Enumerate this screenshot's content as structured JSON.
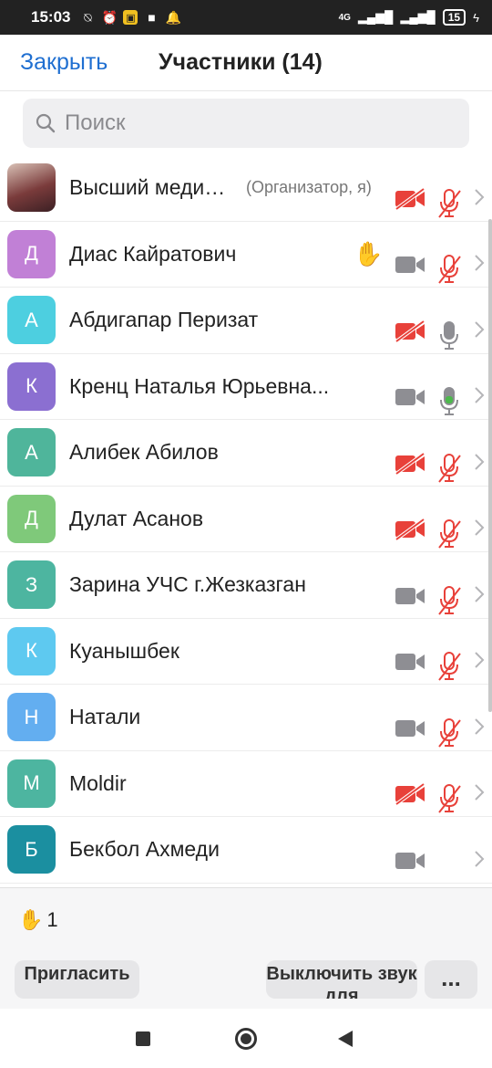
{
  "status_bar": {
    "time": "15:03",
    "network": "4G",
    "battery": "15"
  },
  "header": {
    "close_label": "Закрыть",
    "title": "Участники (14)"
  },
  "search": {
    "placeholder": "Поиск"
  },
  "colors": {
    "accent": "#1f6fd1",
    "muted_red": "#e8413a",
    "icon_gray": "#8e8e93",
    "active_green": "#4cb84c"
  },
  "participants": [
    {
      "avatar": "",
      "avatar_color": "#7a3b3b",
      "name": "Высший меди…",
      "role": "(Организатор, я)",
      "hand": false,
      "video": "off",
      "audio": "muted"
    },
    {
      "avatar": "Д",
      "avatar_color": "#c180d6",
      "name": "Диас Кайратович",
      "role": "",
      "hand": true,
      "video": "on",
      "audio": "muted"
    },
    {
      "avatar": "А",
      "avatar_color": "#4dcfe0",
      "name": "Абдигапар Перизат",
      "role": "",
      "hand": false,
      "video": "off",
      "audio": "unmuted"
    },
    {
      "avatar": "К",
      "avatar_color": "#8b6fd1",
      "name": "Кренц Наталья  Юрьевна...",
      "role": "",
      "hand": false,
      "video": "on",
      "audio": "active"
    },
    {
      "avatar": "А",
      "avatar_color": "#4fb59b",
      "name": "Алибек Абилов",
      "role": "",
      "hand": false,
      "video": "off",
      "audio": "muted"
    },
    {
      "avatar": "Д",
      "avatar_color": "#7fc97a",
      "name": "Дулат Асанов",
      "role": "",
      "hand": false,
      "video": "off",
      "audio": "muted"
    },
    {
      "avatar": "З",
      "avatar_color": "#4db5a0",
      "name": "Зарина УЧС г.Жезказган",
      "role": "",
      "hand": false,
      "video": "on",
      "audio": "muted"
    },
    {
      "avatar": "К",
      "avatar_color": "#5ec9f0",
      "name": "Куанышбек",
      "role": "",
      "hand": false,
      "video": "on",
      "audio": "muted"
    },
    {
      "avatar": "Н",
      "avatar_color": "#63aef0",
      "name": "Натали",
      "role": "",
      "hand": false,
      "video": "on",
      "audio": "muted"
    },
    {
      "avatar": "М",
      "avatar_color": "#4db5a0",
      "name": "Moldir",
      "role": "",
      "hand": false,
      "video": "off",
      "audio": "muted"
    },
    {
      "avatar": "Б",
      "avatar_color": "#1b8fa0",
      "name": "Бекбол Ахмеди",
      "role": "",
      "hand": false,
      "video": "on",
      "audio": "none"
    }
  ],
  "bottom": {
    "raised_hands_count": "1",
    "invite_label": "Пригласить",
    "mute_all_label": "Выключить звук для",
    "more_label": "..."
  }
}
